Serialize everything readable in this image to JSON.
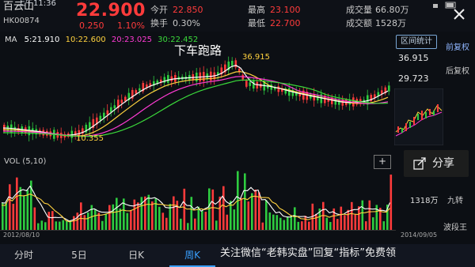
{
  "status_bar": {
    "time": "上午11:36"
  },
  "stock": {
    "name": "百云山",
    "code": "HK00874",
    "price": "22.900",
    "change": "0.250",
    "change_pct": "1.10%"
  },
  "quote": {
    "open_label": "今开",
    "open_value": "22.850",
    "turnover_label": "换手",
    "turnover_value": "0.30%",
    "high_label": "最高",
    "high_value": "23.100",
    "low_label": "最低",
    "low_value": "22.700",
    "volume_label": "成交量",
    "volume_value": "66.80万",
    "amount_label": "成交额",
    "amount_value": "1528万"
  },
  "ma_legend": {
    "title": "MA",
    "ma5": "5:21.910",
    "ma10": "10:22.600",
    "ma20": "20:23.025",
    "ma30": "30:22.452"
  },
  "interval_stats_button": "区间统计",
  "price_axis": {
    "high": "36.915",
    "mid": "29.723"
  },
  "annotations": {
    "overlay_text": "下车跑路",
    "peak_value": "36.915",
    "trough_value": "10.355"
  },
  "sidebar": {
    "item1": "前复权",
    "item2": "后复权",
    "share_label": "分享",
    "item3": "九转",
    "item4": "波段王"
  },
  "volume": {
    "label": "VOL (5,10)",
    "axis_value": "1318万",
    "add_button": "+"
  },
  "dates": {
    "start": "2012/08/10",
    "end": "2014/09/05"
  },
  "tabs": [
    {
      "label": "分时"
    },
    {
      "label": "5日"
    },
    {
      "label": "日K"
    },
    {
      "label": "周K"
    }
  ],
  "footer": {
    "text": "关注微信“老韩实盘”回复“指标”免费领"
  },
  "colors": {
    "up": "#ff3b3b",
    "down": "#2ecc40",
    "accent": "#3aa0ff"
  }
}
